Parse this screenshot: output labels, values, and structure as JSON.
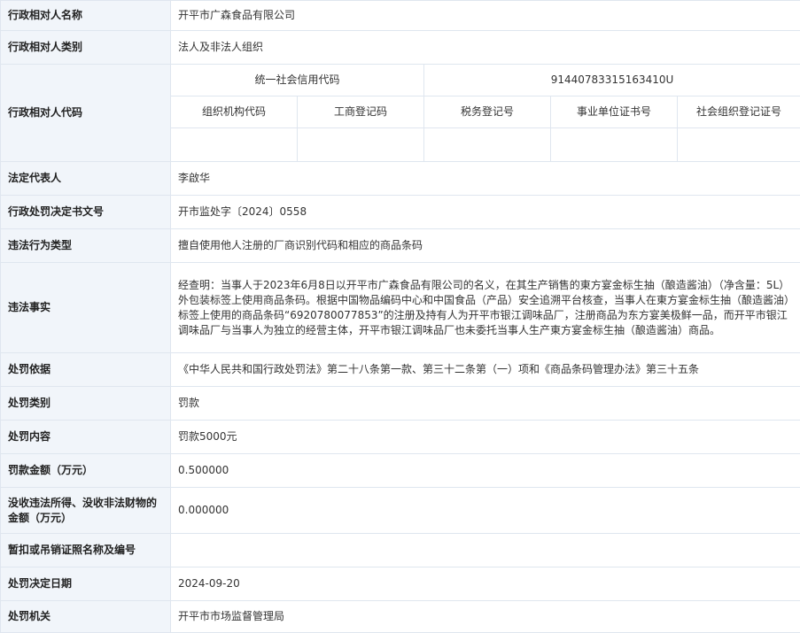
{
  "rows": {
    "party_name": {
      "label": "行政相对人名称",
      "value": "开平市广森食品有限公司"
    },
    "party_category": {
      "label": "行政相对人类别",
      "value": "法人及非法人组织"
    },
    "party_code": {
      "label": "行政相对人代码",
      "credit_code_label": "统一社会信用代码",
      "credit_code_value": "91440783315163410U",
      "sub_headers": [
        "组织机构代码",
        "工商登记码",
        "税务登记号",
        "事业单位证书号",
        "社会组织登记证号"
      ]
    },
    "legal_rep": {
      "label": "法定代表人",
      "value": "李啟华"
    },
    "decision_no": {
      "label": "行政处罚决定书文号",
      "value": "开市监处字〔2024〕0558"
    },
    "violation_type": {
      "label": "违法行为类型",
      "value": "擅自使用他人注册的厂商识别代码和相应的商品条码"
    },
    "facts": {
      "label": "违法事实",
      "value": "经查明：当事人于2023年6月8日以开平市广森食品有限公司的名义，在其生产销售的東方宴金标生抽（酿造酱油）（净含量：5L）外包装标签上使用商品条码。根据中国物品编码中心和中国食品（产品）安全追溯平台核查，当事人在東方宴金标生抽（酿造酱油）标签上使用的商品条码“6920780077853”的注册及持有人为开平市银江调味品厂，注册商品为东方宴美极鲜一品，而开平市银江调味品厂与当事人为独立的经营主体，开平市银江调味品厂也未委托当事人生产東方宴金标生抽（酿造酱油）商品。"
    },
    "basis": {
      "label": "处罚依据",
      "value": "《中华人民共和国行政处罚法》第二十八条第一款、第三十二条第（一）项和《商品条码管理办法》第三十五条"
    },
    "penalty_type": {
      "label": "处罚类别",
      "value": "罚款"
    },
    "penalty_content": {
      "label": "处罚内容",
      "value": "罚款5000元"
    },
    "fine_amount": {
      "label": "罚款金额（万元）",
      "value": "0.500000"
    },
    "confiscation": {
      "label": "没收违法所得、没收非法财物的金额（万元）",
      "value": "0.000000"
    },
    "license": {
      "label": "暂扣或吊销证照名称及编号",
      "value": ""
    },
    "decision_date": {
      "label": "处罚决定日期",
      "value": "2024-09-20"
    },
    "authority": {
      "label": "处罚机关",
      "value": "开平市市场监督管理局"
    }
  }
}
